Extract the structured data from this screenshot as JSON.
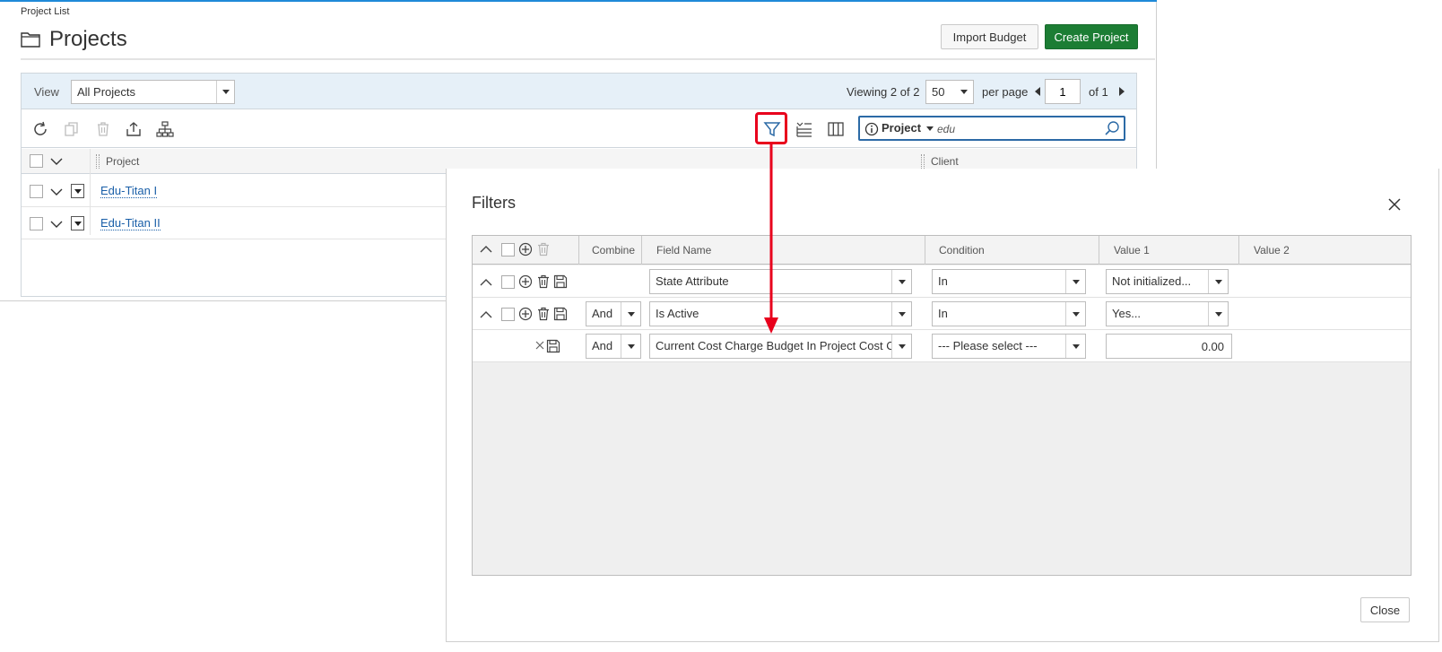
{
  "breadcrumb": "Project List",
  "page_title": "Projects",
  "header_buttons": {
    "import_budget": "Import Budget",
    "create_project": "Create Project"
  },
  "view_bar": {
    "view_label": "View",
    "view_selected": "All Projects",
    "viewing_text": "Viewing 2 of 2",
    "per_page_selected": "50",
    "per_page_label": "per page",
    "page_number": "1",
    "of_pages": "of 1"
  },
  "search": {
    "scope": "Project",
    "value": "edu"
  },
  "grid": {
    "columns": {
      "project": "Project",
      "client": "Client"
    },
    "rows": [
      {
        "project": "Edu-Titan I"
      },
      {
        "project": "Edu-Titan II"
      }
    ]
  },
  "filters_modal": {
    "title": "Filters",
    "columns": {
      "combine": "Combine",
      "field_name": "Field Name",
      "condition": "Condition",
      "value1": "Value 1",
      "value2": "Value 2"
    },
    "rows": [
      {
        "combine": "",
        "field_name": "State Attribute",
        "condition": "In",
        "value1": "Not initialized..."
      },
      {
        "combine": "And",
        "field_name": "Is Active",
        "condition": "In",
        "value1": "Yes..."
      },
      {
        "combine": "And",
        "field_name": "Current Cost Charge Budget In Project Cost Curr...",
        "condition": "--- Please select ---",
        "value1": "0.00"
      }
    ],
    "close_label": "Close"
  },
  "colors": {
    "accent_blue": "#1f8ad8",
    "create_green": "#1c7d34",
    "annotation_red": "#e8001c",
    "link_blue": "#1a5fa8"
  },
  "icons": [
    "folder-icon",
    "refresh-icon",
    "copy-icon",
    "delete-icon",
    "export-icon",
    "hierarchy-icon",
    "filter-icon",
    "group-icon",
    "columns-icon",
    "info-icon",
    "search-icon",
    "close-icon",
    "collapse-icon",
    "add-icon",
    "save-icon"
  ]
}
